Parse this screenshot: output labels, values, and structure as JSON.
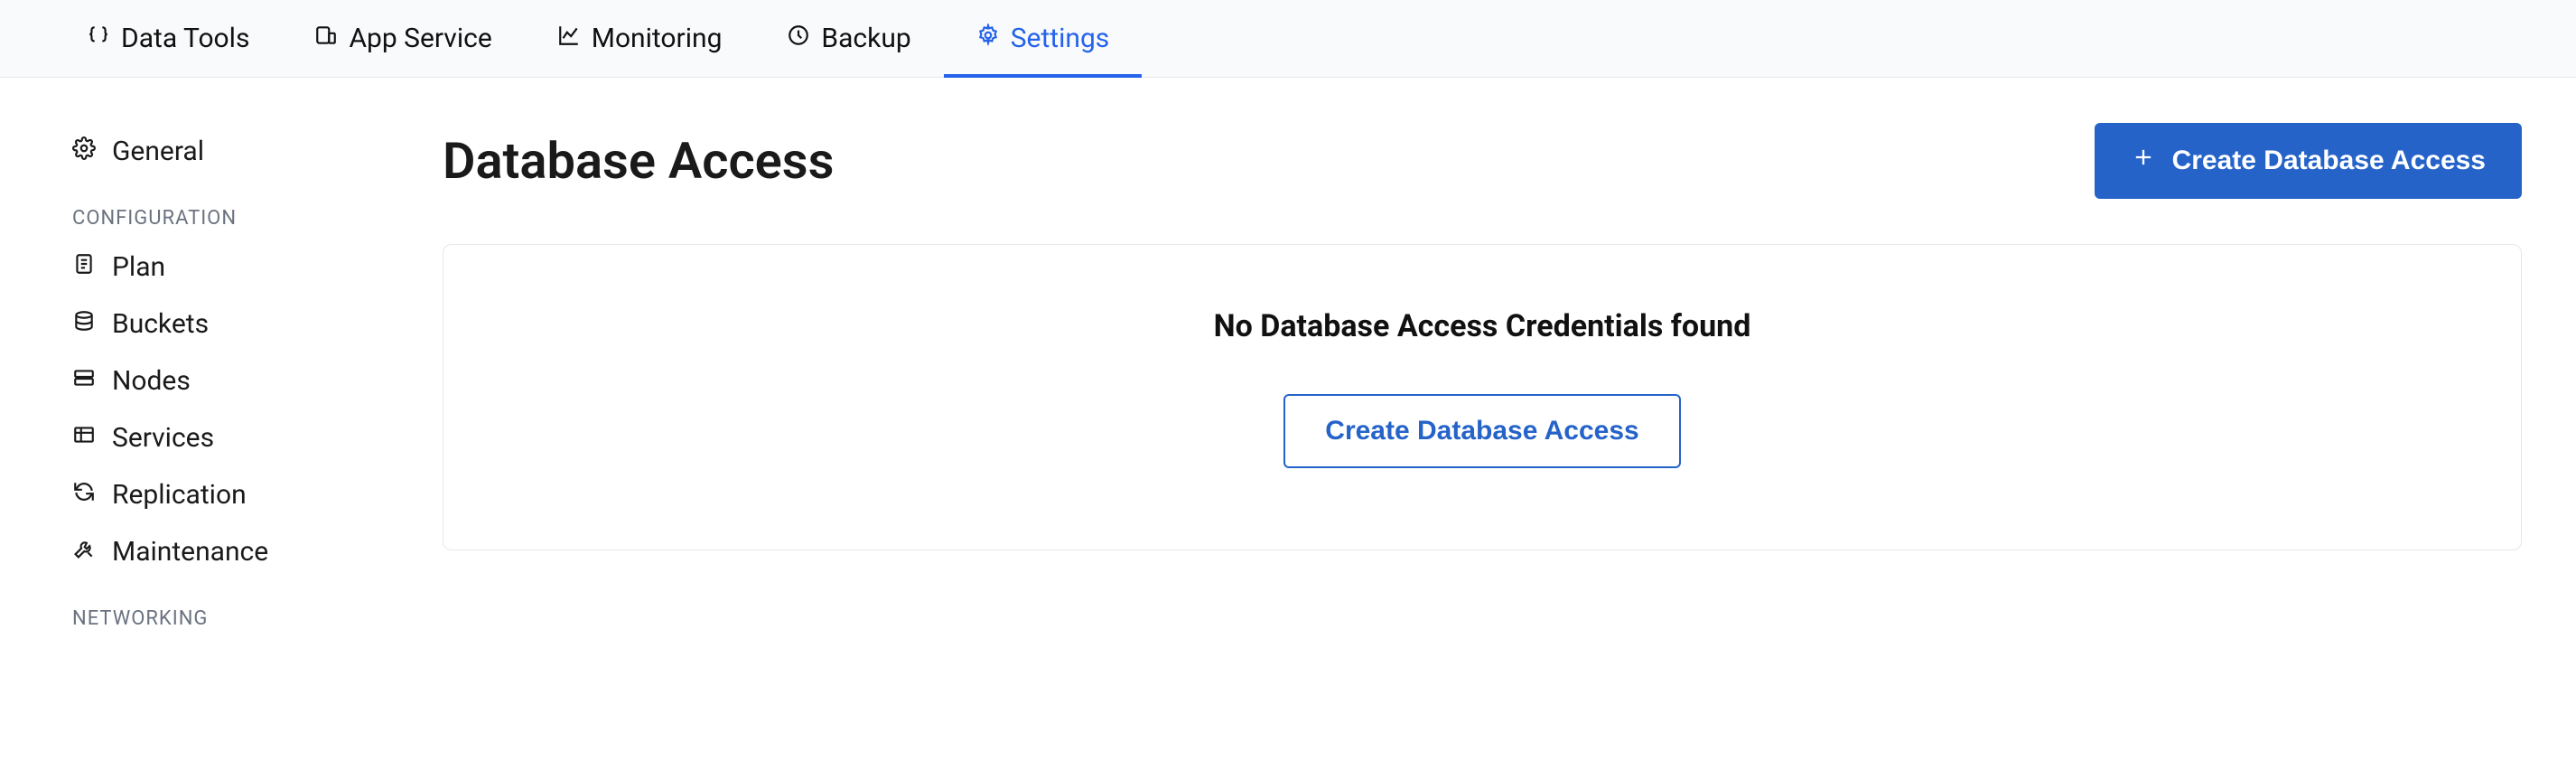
{
  "tabs": {
    "data_tools": "Data Tools",
    "app_service": "App Service",
    "monitoring": "Monitoring",
    "backup": "Backup",
    "settings": "Settings"
  },
  "sidebar": {
    "general": "General",
    "section_configuration": "CONFIGURATION",
    "plan": "Plan",
    "buckets": "Buckets",
    "nodes": "Nodes",
    "services": "Services",
    "replication": "Replication",
    "maintenance": "Maintenance",
    "section_networking": "NETWORKING"
  },
  "page": {
    "title": "Database Access",
    "create_button": "Create Database Access"
  },
  "empty": {
    "title": "No Database Access Credentials found",
    "action": "Create Database Access"
  }
}
